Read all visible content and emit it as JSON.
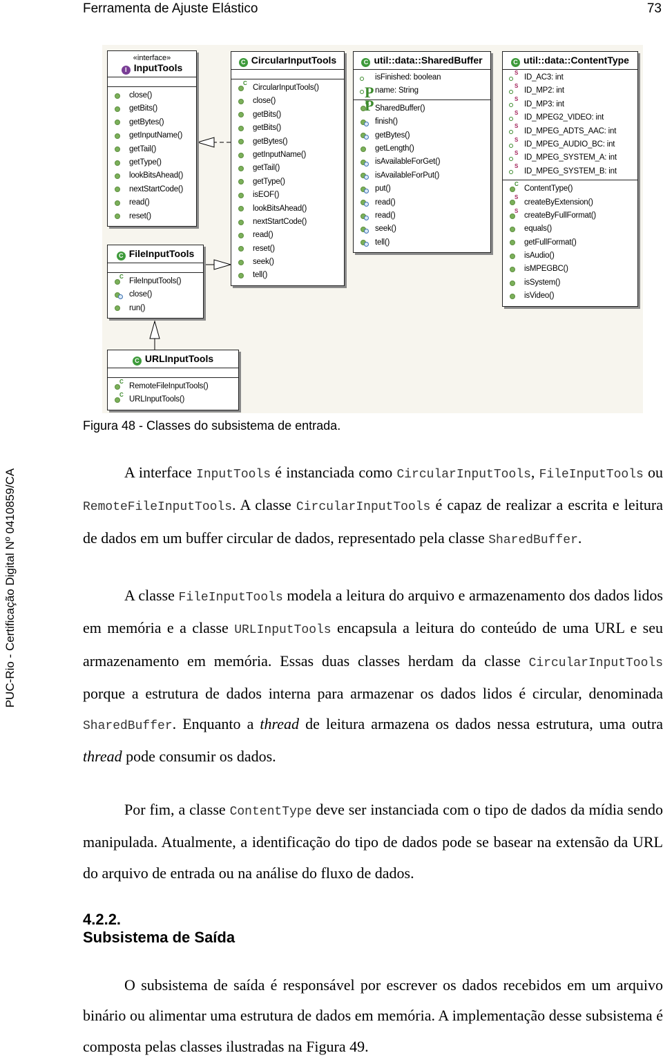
{
  "header": {
    "title": "Ferramenta de Ajuste Elástico",
    "page_number": "73"
  },
  "side_watermark": "PUC-Rio - Certificação Digital Nº 0410859/CA",
  "figure": {
    "caption": "Figura 48 - Classes do subsistema de entrada.",
    "classes": {
      "input_tools": {
        "stereotype": "«interface»",
        "name": "InputTools",
        "badge": "I",
        "attributes": [],
        "operations": [
          "close()",
          "getBits()",
          "getBytes()",
          "getInputName()",
          "getTail()",
          "getType()",
          "lookBitsAhead()",
          "nextStartCode()",
          "read()",
          "reset()"
        ]
      },
      "circular_input_tools": {
        "name": "CircularInputTools",
        "badge": "C",
        "attributes": [],
        "operations": [
          "CircularInputTools()",
          "close()",
          "getBits()",
          "getBits()",
          "getBytes()",
          "getInputName()",
          "getTail()",
          "getType()",
          "isEOF()",
          "lookBitsAhead()",
          "nextStartCode()",
          "read()",
          "reset()",
          "seek()",
          "tell()"
        ]
      },
      "shared_buffer": {
        "name": "util::data::SharedBuffer",
        "badge": "C",
        "attributes": [
          "isFinished: boolean",
          "name: String"
        ],
        "operations": [
          "SharedBuffer()",
          "finish()",
          "getBytes()",
          "getLength()",
          "isAvailableForGet()",
          "isAvailableForPut()",
          "put()",
          "read()",
          "read()",
          "seek()",
          "tell()"
        ]
      },
      "content_type": {
        "name": "util::data::ContentType",
        "badge": "C",
        "attributes": [
          "ID_AC3: int",
          "ID_MP2: int",
          "ID_MP3: int",
          "ID_MPEG2_VIDEO: int",
          "ID_MPEG_ADTS_AAC: int",
          "ID_MPEG_AUDIO_BC: int",
          "ID_MPEG_SYSTEM_A: int",
          "ID_MPEG_SYSTEM_B: int"
        ],
        "operations": [
          "ContentType()",
          "createByExtension()",
          "createByFullFormat()",
          "equals()",
          "getFullFormat()",
          "isAudio()",
          "isMPEGBC()",
          "isSystem()",
          "isVideo()"
        ]
      },
      "file_input_tools": {
        "name": "FileInputTools",
        "badge": "C",
        "attributes": [],
        "operations": [
          "FileInputTools()",
          "close()",
          "run()"
        ]
      },
      "url_input_tools": {
        "name": "URLInputTools",
        "badge": "C",
        "attributes": [],
        "operations": [
          "RemoteFileInputTools()",
          "URLInputTools()"
        ]
      }
    }
  },
  "paragraphs": {
    "p1": {
      "t1": "A interface ",
      "c1": "InputTools",
      "t2": " é instanciada como ",
      "c2": "CircularInputTools",
      "t3": ", ",
      "c3": "FileInputTools",
      "t4": " ou ",
      "c4": "RemoteFileInputTools",
      "t5": ". A classe ",
      "c5": "CircularInputTools",
      "t6": " é capaz de realizar a escrita e leitura de dados em um buffer circular de dados, representado pela classe ",
      "c6": "SharedBuffer",
      "t7": "."
    },
    "p2": {
      "t1": "A classe ",
      "c1": "FileInputTools",
      "t2": " modela a leitura do arquivo e armazenamento dos dados lidos em memória e a classe ",
      "c2": "URLInputTools",
      "t3": " encapsula a leitura do conteúdo de uma URL e seu armazenamento em memória. Essas duas classes herdam da classe ",
      "c3": "CircularInputTools",
      "t4": " porque a estrutura de dados interna para armazenar os dados lidos é circular, denominada ",
      "c4": "SharedBuffer",
      "t5": ". Enquanto a ",
      "i1": "thread",
      "t6": " de leitura armazena os dados nessa estrutura, uma outra ",
      "i2": "thread",
      "t7": " pode consumir os dados."
    },
    "p3": {
      "t1": "Por fim, a classe ",
      "c1": "ContentType",
      "t2": " deve ser instanciada com o tipo de dados da mídia sendo manipulada. Atualmente, a identificação do tipo de dados pode se basear na extensão da URL do arquivo de entrada ou na análise do fluxo de dados."
    },
    "section": {
      "number": "4.2.2.",
      "title": "Subsistema de Saída"
    },
    "p4": {
      "t1": "O subsistema de saída é responsável por escrever os dados recebidos em um arquivo binário ou alimentar uma estrutura de dados em memória. A implementação desse subsistema é composta pelas classes ilustradas na Figura 49."
    }
  }
}
